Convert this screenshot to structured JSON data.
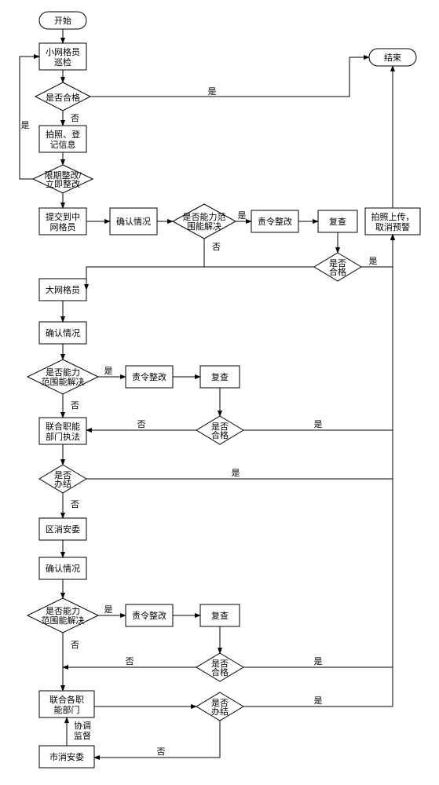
{
  "nodes": {
    "start": "开始",
    "end": "结束",
    "patrol": "小网格员巡检",
    "qualified1": "是否合格",
    "photo_register": "拍照、登记信息",
    "deadline_rectify": "限期整改/立即整改",
    "submit_mid": "提交到中网格员",
    "confirm1": "确认情况",
    "capable1": "是否能力范围能解决",
    "order_rectify1": "责令整改",
    "review1": "复查",
    "qualified2": "是否合格",
    "large_grid": "大网格员",
    "confirm2": "确认情况",
    "capable2": "是否能力范围能解决",
    "order_rectify2": "责令整改",
    "review2": "复查",
    "joint_enforce": "联合职能部门执法",
    "qualified3": "是否合格",
    "concluded1": "是否办结",
    "district_committee": "区消安委",
    "confirm3": "确认情况",
    "capable3": "是否能力范围能解决",
    "order_rectify3": "责令整改",
    "review3": "复查",
    "qualified4": "是否合格",
    "joint_depts": "联合各职能部门",
    "concluded2": "是否办结",
    "coord_supervise": "协调监督",
    "city_committee": "市消安委",
    "upload_cancel": "拍照上传，取消预警"
  },
  "labels": {
    "yes": "是",
    "no": "否"
  }
}
